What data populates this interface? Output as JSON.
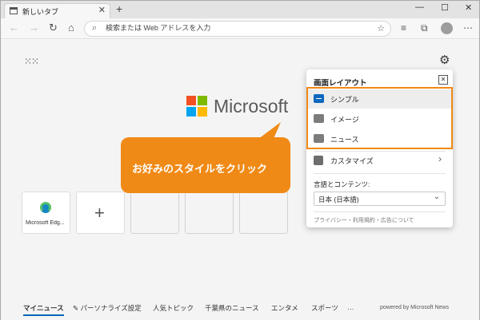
{
  "browser": {
    "tab_title": "新しいタブ",
    "tab_close": "✕",
    "new_tab": "+",
    "window_controls": [
      "—",
      "☐",
      "✕"
    ],
    "nav": {
      "back": "←",
      "forward": "→",
      "refresh": "↻",
      "home": "⌂"
    },
    "address_placeholder": "検索または Web アドレスを入力"
  },
  "newtab": {
    "brand": "Microsoft",
    "brand_colors": [
      "#f25022",
      "#7fba00",
      "#00a4ef",
      "#ffb900"
    ],
    "tiles": [
      {
        "label": "Microsoft Edg..."
      },
      {
        "label": "+"
      }
    ],
    "bottom_nav": [
      "マイニュース",
      "パーソナライズ設定",
      "人気トピック",
      "千葉県のニュース",
      "エンタメ",
      "スポーツ",
      "…"
    ],
    "powered_by": "powered by Microsoft News"
  },
  "layout_panel": {
    "title": "画面レイアウト",
    "options": [
      {
        "label": "シンプル",
        "selected": true
      },
      {
        "label": "イメージ",
        "selected": false
      },
      {
        "label": "ニュース",
        "selected": false
      }
    ],
    "customize": "カスタマイズ",
    "lang_label": "言語とコンテンツ:",
    "lang_value": "日本 (日本語)",
    "privacy": "プライバシー・利用規約・広告について"
  },
  "callout": {
    "text": "お好みのスタイルをクリック",
    "color": "#f08a16"
  }
}
